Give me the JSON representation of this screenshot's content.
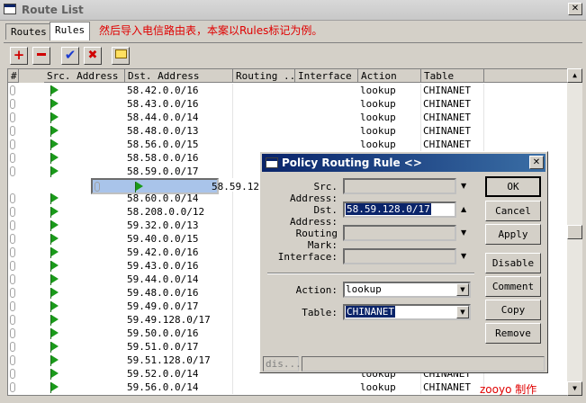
{
  "window": {
    "title": "Route List"
  },
  "tabs": [
    {
      "label": "Routes"
    },
    {
      "label": "Rules"
    }
  ],
  "note": "然后导入电信路由表，本案以Rules标记为例。",
  "toolbar": {
    "add": "add-icon",
    "remove": "remove-icon",
    "enable": "check-icon",
    "disable": "x-icon",
    "comment": "note-icon"
  },
  "columns": [
    "#",
    "Src. Address",
    "Dst. Address",
    "Routing ...",
    "Interface",
    "Action",
    "Table"
  ],
  "rows": [
    {
      "dst": "58.42.0.0/16",
      "action": "lookup",
      "table": "CHINANET"
    },
    {
      "dst": "58.43.0.0/16",
      "action": "lookup",
      "table": "CHINANET"
    },
    {
      "dst": "58.44.0.0/14",
      "action": "lookup",
      "table": "CHINANET"
    },
    {
      "dst": "58.48.0.0/13",
      "action": "lookup",
      "table": "CHINANET"
    },
    {
      "dst": "58.56.0.0/15",
      "action": "lookup",
      "table": "CHINANET"
    },
    {
      "dst": "58.58.0.0/16",
      "action": "",
      "table": ""
    },
    {
      "dst": "58.59.0.0/17",
      "action": "",
      "table": ""
    },
    {
      "dst": "58.59.128.0/17",
      "action": "",
      "table": "",
      "selected": true
    },
    {
      "dst": "58.60.0.0/14",
      "action": "",
      "table": ""
    },
    {
      "dst": "58.208.0.0/12",
      "action": "",
      "table": ""
    },
    {
      "dst": "59.32.0.0/13",
      "action": "",
      "table": ""
    },
    {
      "dst": "59.40.0.0/15",
      "action": "",
      "table": ""
    },
    {
      "dst": "59.42.0.0/16",
      "action": "",
      "table": ""
    },
    {
      "dst": "59.43.0.0/16",
      "action": "",
      "table": ""
    },
    {
      "dst": "59.44.0.0/14",
      "action": "",
      "table": ""
    },
    {
      "dst": "59.48.0.0/16",
      "action": "",
      "table": ""
    },
    {
      "dst": "59.49.0.0/17",
      "action": "",
      "table": ""
    },
    {
      "dst": "59.49.128.0/17",
      "action": "",
      "table": ""
    },
    {
      "dst": "59.50.0.0/16",
      "action": "",
      "table": ""
    },
    {
      "dst": "59.51.0.0/17",
      "action": "",
      "table": ""
    },
    {
      "dst": "59.51.128.0/17",
      "action": "",
      "table": ""
    },
    {
      "dst": "59.52.0.0/14",
      "action": "lookup",
      "table": "CHINANET"
    },
    {
      "dst": "59.56.0.0/14",
      "action": "lookup",
      "table": "CHINANET"
    }
  ],
  "watermark": "zooyo 制作",
  "dialog": {
    "title": "Policy Routing Rule <>",
    "labels": {
      "src": "Src. Address:",
      "dst": "Dst. Address:",
      "mark": "Routing Mark:",
      "iface": "Interface:",
      "action": "Action:",
      "table": "Table:"
    },
    "values": {
      "src": "",
      "dst": "58.59.128.0/17",
      "mark": "",
      "iface": "",
      "action": "lookup",
      "table": "CHINANET"
    },
    "buttons": {
      "ok": "OK",
      "cancel": "Cancel",
      "apply": "Apply",
      "disable": "Disable",
      "comment": "Comment",
      "copy": "Copy",
      "remove": "Remove"
    },
    "status": "dis..."
  }
}
